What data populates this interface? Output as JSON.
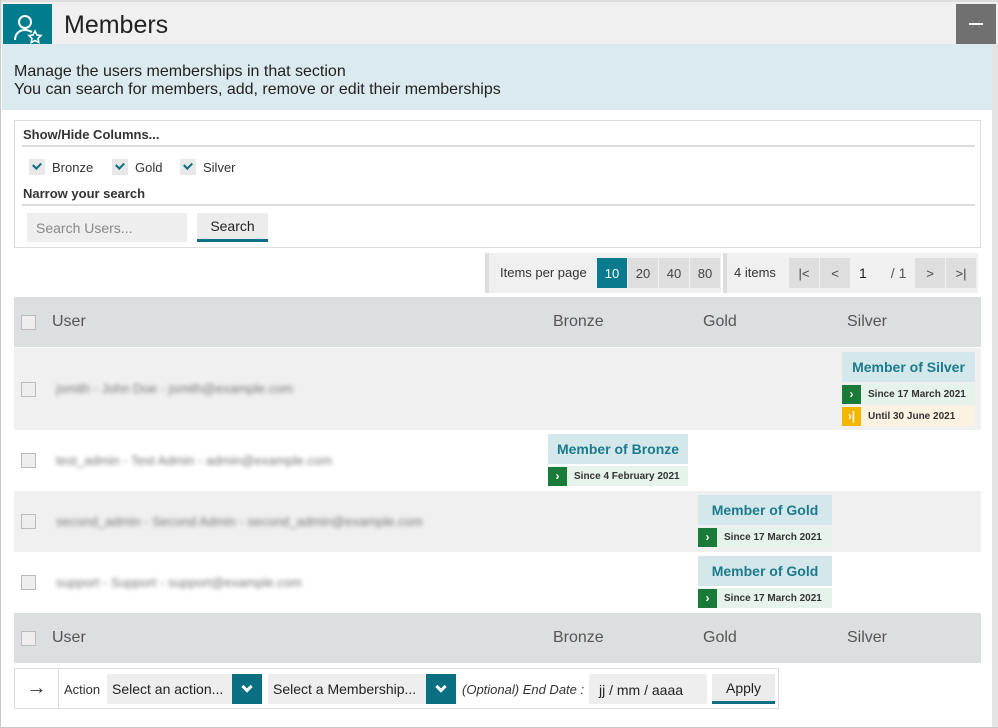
{
  "header": {
    "title": "Members",
    "icon": "user-star-icon",
    "minimize_icon": "minimize-icon"
  },
  "intro": {
    "line1": "Manage the users memberships in that section",
    "line2": "You can search for members, add, remove or edit their memberships"
  },
  "filters": {
    "columns_title": "Show/Hide Columns...",
    "columns": [
      {
        "label": "Bronze",
        "checked": true
      },
      {
        "label": "Gold",
        "checked": true
      },
      {
        "label": "Silver",
        "checked": true
      }
    ],
    "search_title": "Narrow your search",
    "search_placeholder": "Search Users...",
    "search_button": "Search"
  },
  "pagination": {
    "items_per_page_label": "Items per page",
    "page_sizes": [
      "10",
      "20",
      "40",
      "80"
    ],
    "selected_page_size": "10",
    "items_count": "4 items",
    "first": "|<",
    "prev": "<",
    "current_page": "1",
    "total_pages": "/ 1",
    "next": ">",
    "last": ">|"
  },
  "table": {
    "headers": {
      "user": "User",
      "bronze": "Bronze",
      "gold": "Gold",
      "silver": "Silver"
    },
    "rows": [
      {
        "user": "jsmith - John Doe - jsmith@example.com",
        "link": "John Doe",
        "silver": {
          "title": "Member of Silver",
          "since": "Since 17 March 2021",
          "until": "Until 30 June 2021"
        }
      },
      {
        "user": "test_admin - Test Admin - admin@example.com",
        "link": "Test Admin",
        "bronze": {
          "title": "Member of Bronze",
          "since": "Since 4 February 2021"
        }
      },
      {
        "user": "second_admin - Second Admin - second_admin@example.com",
        "link": "Second Admin",
        "gold": {
          "title": "Member of Gold",
          "since": "Since 17 March 2021"
        }
      },
      {
        "user": "support - Support - support@example.com",
        "link": "Support",
        "gold": {
          "title": "Member of Gold",
          "since": "Since 17 March 2021"
        }
      }
    ]
  },
  "actions": {
    "arrow_icon": "arrow-right-icon",
    "label": "Action",
    "action_select": "Select an action...",
    "membership_select": "Select a Membership...",
    "end_date_label": "(Optional) End Date :",
    "end_date_value": "jj / mm / aaaa",
    "apply": "Apply"
  },
  "colors": {
    "accent": "#0a6f80",
    "header_bg": "#dcdfdf",
    "intro_bg": "#dbeaee",
    "since_green": "#197a3a",
    "until_yellow": "#f3b700"
  }
}
